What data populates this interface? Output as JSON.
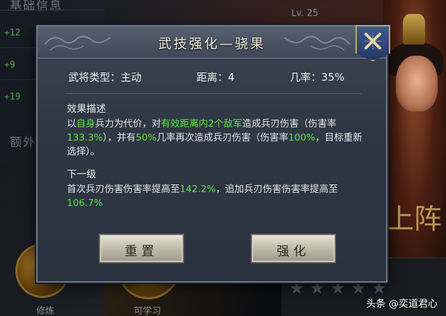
{
  "background": {
    "panel_title": "基础信息",
    "stats": [
      "+12",
      "+9",
      "+19"
    ],
    "extra_title": "额外",
    "level": "Lv. 25",
    "banner_char": "上阵",
    "bottom_labels": [
      "修炼",
      "可学习"
    ]
  },
  "dialog": {
    "title": "武技强化—骁果",
    "info": {
      "type": "武将类型：主动",
      "range": "距离：4",
      "chance": "几率：35%"
    },
    "effect_label": "效果描述",
    "effect_parts": {
      "p1": "以",
      "h1": "自身",
      "p2": "兵力为代价，对",
      "h2": "有效距离内2个敌军",
      "p3": "造成兵刃伤害（伤害率",
      "h3": "133.3%",
      "p4": "），并有",
      "h4": "50%",
      "p5": "几率再次造成兵刃伤害（伤害率",
      "h5": "100%",
      "p6": "，目标重新选择）。"
    },
    "next_label": "下一级",
    "next_parts": {
      "p1": "首次兵刃伤害伤害率提高至",
      "h1": "142.2%",
      "p2": "，追加兵刃伤害伤害率提高至",
      "h2": "106.7%"
    },
    "buttons": {
      "reset": "重置",
      "upgrade": "强化"
    }
  },
  "watermark": "头条 @奕道君心",
  "colors": {
    "highlight": "#5fe046",
    "stat_green": "#4fb24f",
    "dialog_bg": "#2f3744",
    "close_bg": "#23386a",
    "gold": "#c9a95a"
  }
}
